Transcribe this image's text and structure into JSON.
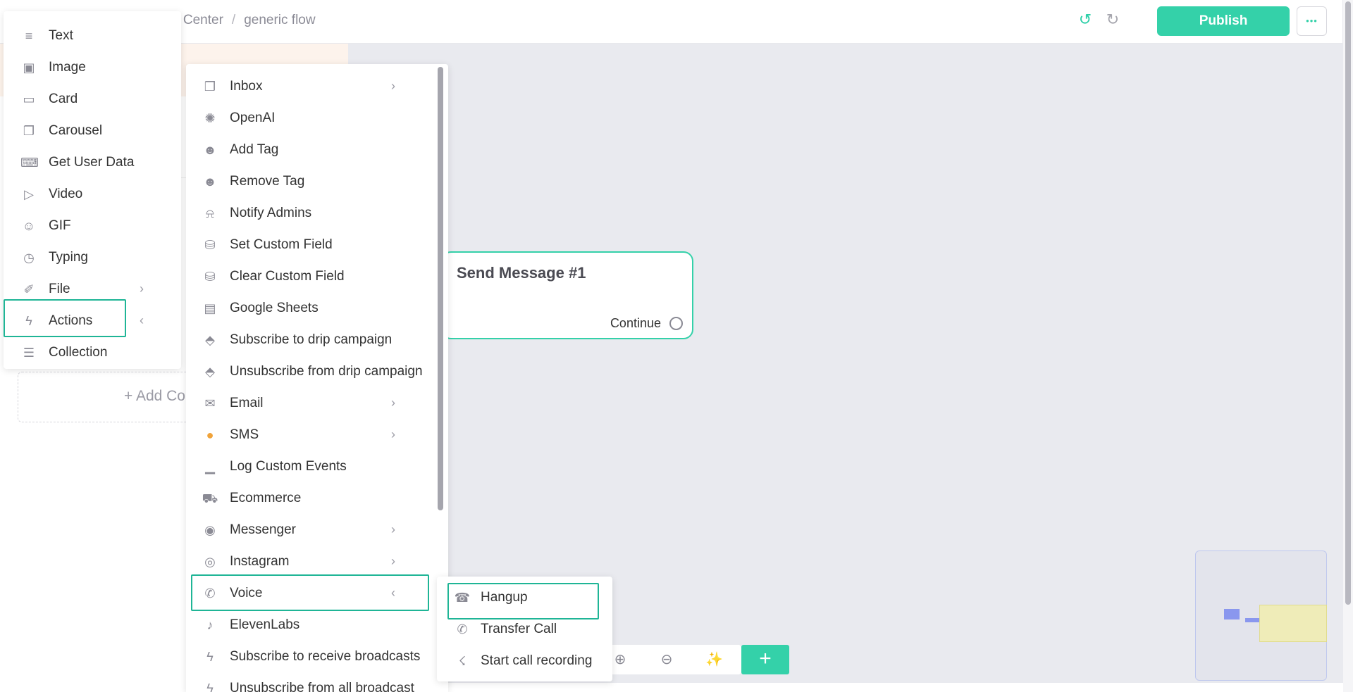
{
  "header": {
    "breadcrumb_parent": "rt Center",
    "breadcrumb_separator": "/",
    "breadcrumb_current": "generic flow",
    "publish_label": "Publish",
    "more_label": "•••"
  },
  "canvas": {
    "node_title": "Send Message #1",
    "node_continue": "Continue",
    "add_content_label": "+ Add Co",
    "plus_label": "+"
  },
  "colors": {
    "accent": "#34d1a9",
    "highlight": "#1fb596",
    "canvas": "#e9eaef"
  },
  "content_menu": {
    "items": [
      {
        "label": "Text",
        "icon": "text-align-icon",
        "glyph": "≡"
      },
      {
        "label": "Image",
        "icon": "image-icon",
        "glyph": "▣"
      },
      {
        "label": "Card",
        "icon": "card-icon",
        "glyph": "▭"
      },
      {
        "label": "Carousel",
        "icon": "carousel-icon",
        "glyph": "❐"
      },
      {
        "label": "Get User Data",
        "icon": "keyboard-icon",
        "glyph": "⌨"
      },
      {
        "label": "Video",
        "icon": "video-icon",
        "glyph": "▷"
      },
      {
        "label": "GIF",
        "icon": "smiley-icon",
        "glyph": "☺"
      },
      {
        "label": "Typing",
        "icon": "clock-icon",
        "glyph": "◷"
      },
      {
        "label": "File",
        "icon": "paperclip-icon",
        "glyph": "✐",
        "chevron": "›"
      },
      {
        "label": "Actions",
        "icon": "lightning-icon",
        "glyph": "ϟ",
        "chevron": "‹"
      },
      {
        "label": "Collection",
        "icon": "list-icon",
        "glyph": "☰"
      }
    ]
  },
  "actions_menu": {
    "items": [
      {
        "label": "Inbox",
        "icon": "chat-icon",
        "glyph": "❒",
        "chevron": "›"
      },
      {
        "label": "OpenAI",
        "icon": "openai-icon",
        "glyph": "✺"
      },
      {
        "label": "Add Tag",
        "icon": "user-tag-icon",
        "glyph": "☻"
      },
      {
        "label": "Remove Tag",
        "icon": "user-tag-icon",
        "glyph": "☻"
      },
      {
        "label": "Notify Admins",
        "icon": "bell-icon",
        "glyph": "⍾"
      },
      {
        "label": "Set Custom Field",
        "icon": "database-icon",
        "glyph": "⛁"
      },
      {
        "label": "Clear Custom Field",
        "icon": "database-icon",
        "glyph": "⛁"
      },
      {
        "label": "Google Sheets",
        "icon": "sheet-icon",
        "glyph": "▤"
      },
      {
        "label": "Subscribe to drip campaign",
        "icon": "layers-icon",
        "glyph": "⬘"
      },
      {
        "label": "Unsubscribe from drip campaign",
        "icon": "layers-icon",
        "glyph": "⬘"
      },
      {
        "label": "Email",
        "icon": "mail-icon",
        "glyph": "✉",
        "chevron": "›"
      },
      {
        "label": "SMS",
        "icon": "sms-icon",
        "glyph": "●",
        "chevron": "›"
      },
      {
        "label": "Log Custom Events",
        "icon": "chart-icon",
        "glyph": "▁"
      },
      {
        "label": "Ecommerce",
        "icon": "cart-icon",
        "glyph": "⛟"
      },
      {
        "label": "Messenger",
        "icon": "messenger-icon",
        "glyph": "◉",
        "chevron": "›"
      },
      {
        "label": "Instagram",
        "icon": "instagram-icon",
        "glyph": "◎",
        "chevron": "›"
      },
      {
        "label": "Voice",
        "icon": "phone-icon",
        "glyph": "✆",
        "chevron": "‹"
      },
      {
        "label": "ElevenLabs",
        "icon": "speaker-icon",
        "glyph": "♪"
      },
      {
        "label": "Subscribe to receive broadcasts",
        "icon": "lightning-icon",
        "glyph": "ϟ"
      },
      {
        "label": "Unsubscribe from all broadcast",
        "icon": "lightning-icon",
        "glyph": "ϟ"
      }
    ]
  },
  "voice_menu": {
    "items": [
      {
        "label": "Hangup",
        "icon": "hangup-icon",
        "glyph": "☎"
      },
      {
        "label": "Transfer Call",
        "icon": "phone-transfer-icon",
        "glyph": "✆"
      },
      {
        "label": "Start call recording",
        "icon": "microphone-icon",
        "glyph": "☇"
      }
    ]
  }
}
